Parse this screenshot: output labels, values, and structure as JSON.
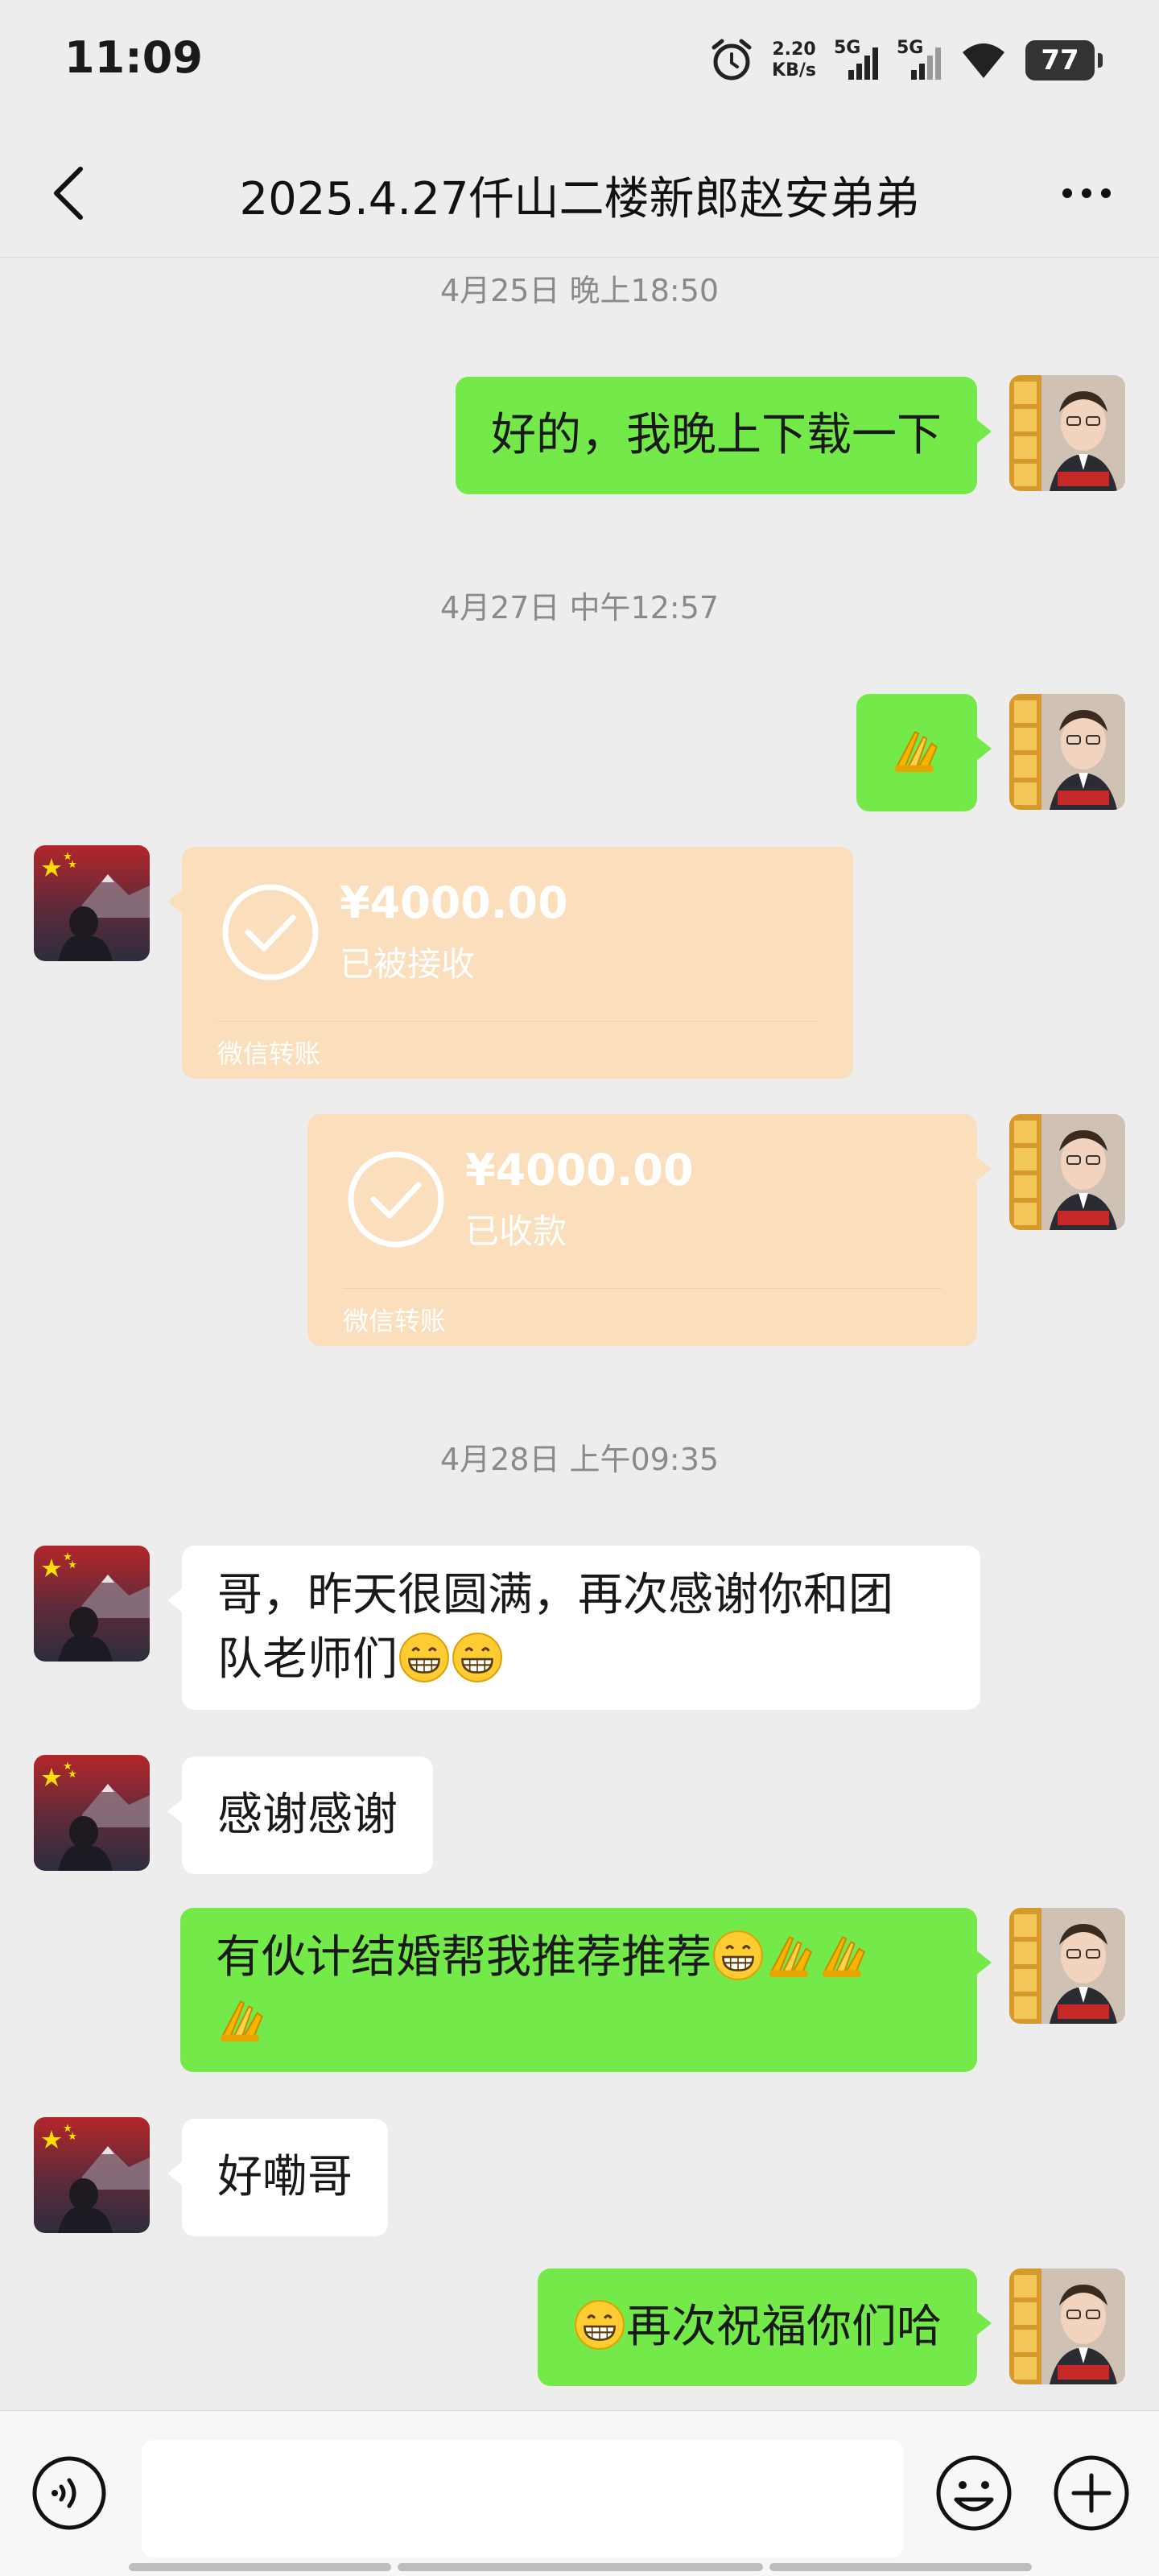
{
  "status_bar": {
    "time": "11:09",
    "speed_value": "2.20",
    "speed_unit": "KB/s",
    "net1": "5G",
    "net2": "5G",
    "battery": "77"
  },
  "nav": {
    "title": "2025.4.27仟山二楼新郎赵安弟弟"
  },
  "messages": {
    "t1": "4月25日 晚上18:50",
    "m1": "好的，我晚上下载一下",
    "t2": "4月27日 中午12:57",
    "transfer1": {
      "amount": "¥4000.00",
      "status": "已被接收",
      "footer": "微信转账"
    },
    "transfer2": {
      "amount": "¥4000.00",
      "status": "已收款",
      "footer": "微信转账"
    },
    "t3": "4月28日 上午09:35",
    "m3_line1": "哥，昨天很圆满，再次感谢你和团",
    "m3_line2": "队老师们",
    "m4": "感谢感谢",
    "m5": "有伙计结婚帮我推荐推荐",
    "m6": "好嘞哥",
    "m7": "再次祝福你们哈"
  },
  "colors": {
    "self_bubble": "#74ea4a",
    "other_bubble": "#ffffff",
    "transfer_bubble": "#fbdfbd",
    "background": "#ededed"
  },
  "icons": {
    "back": "chevron-left-icon",
    "more": "more-dots-icon",
    "voice": "voice-icon",
    "emoji": "smiley-icon",
    "plus": "plus-icon",
    "grin": "grinning-emoji",
    "pray": "praying-hands-emoji"
  }
}
